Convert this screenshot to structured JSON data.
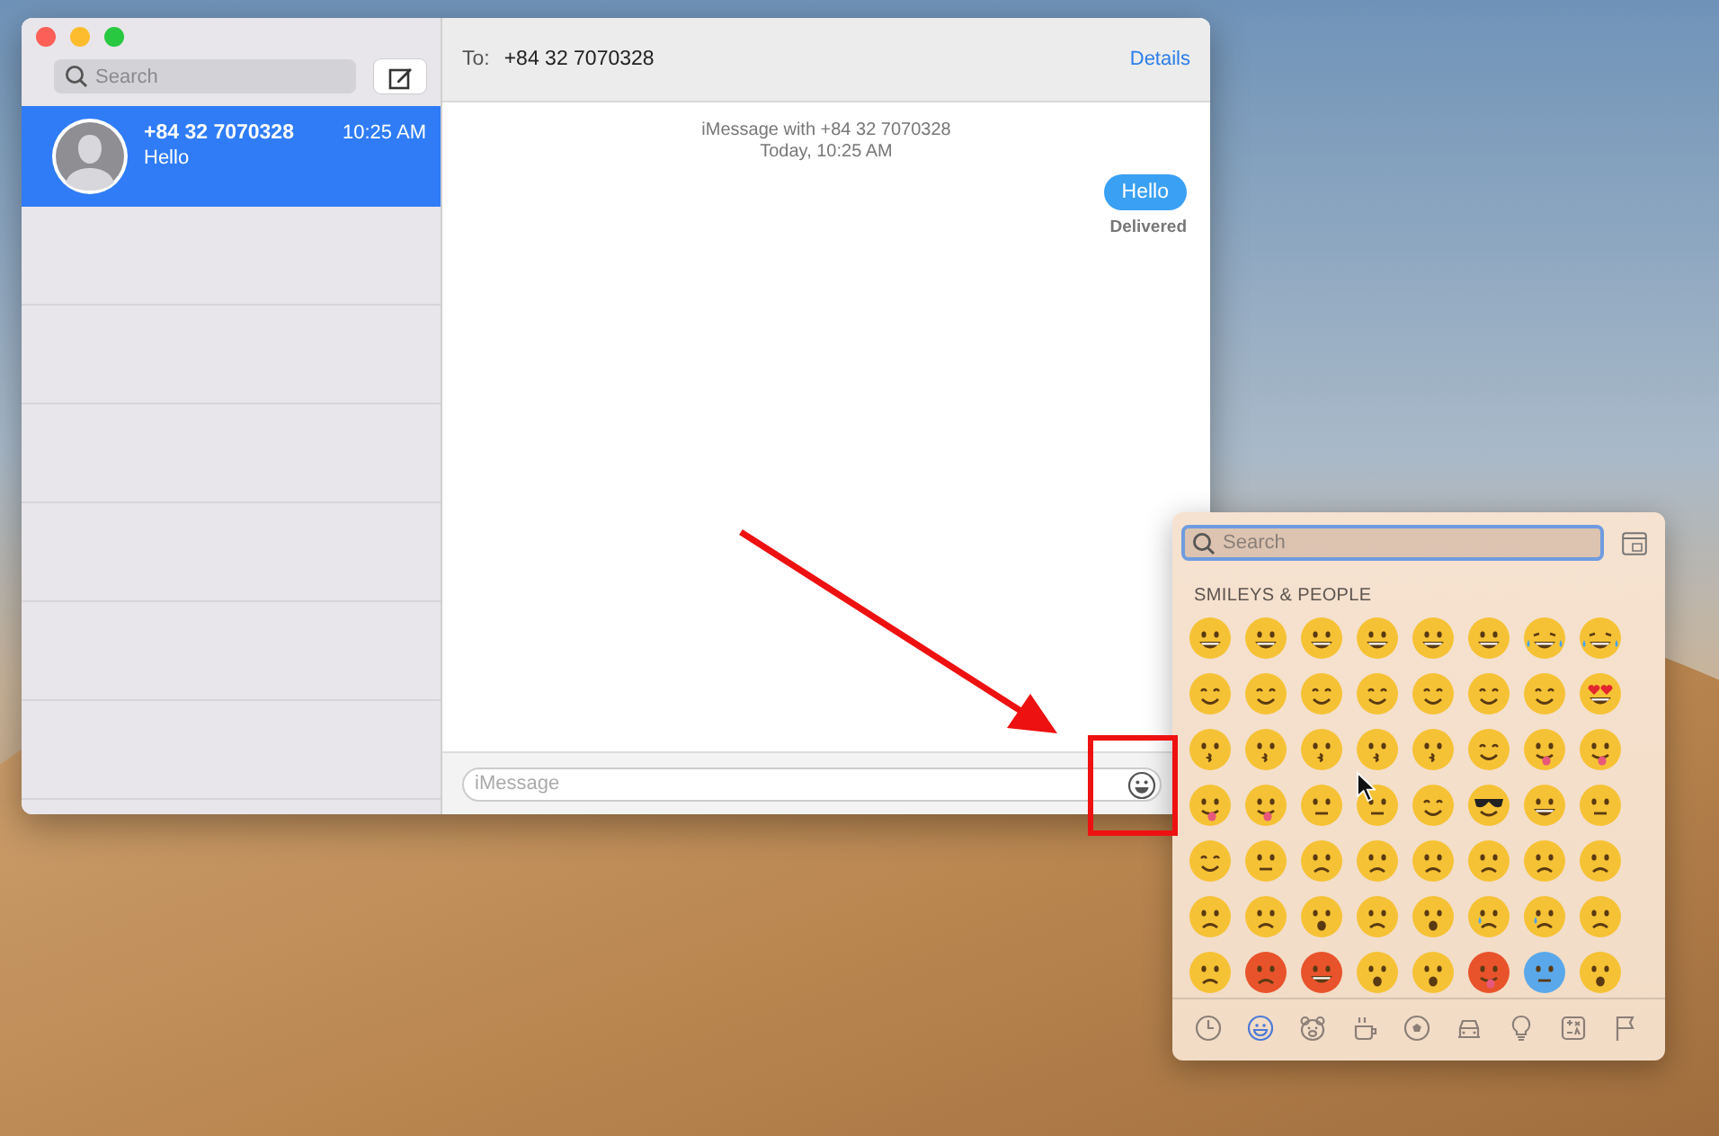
{
  "window": {
    "controls": [
      {
        "color": "#fc5f57"
      },
      {
        "color": "#fdbc2e"
      },
      {
        "color": "#28c840"
      }
    ]
  },
  "sidebar": {
    "search": {
      "placeholder": "Search"
    },
    "conversations": [
      {
        "name": "+84 32 7070328",
        "time": "10:25 AM",
        "preview": "Hello",
        "selected": true
      }
    ]
  },
  "conversation": {
    "to_label": "To:",
    "recipient": "+84 32 7070328",
    "details": "Details",
    "header": "iMessage with +84 32 7070328",
    "date": "Today, 10:25 AM",
    "messages": [
      {
        "text": "Hello",
        "outgoing": true,
        "status": "Delivered"
      }
    ],
    "input": {
      "placeholder": "iMessage"
    }
  },
  "emoji_picker": {
    "search": {
      "placeholder": "Search",
      "focused": true
    },
    "section": "SMILEYS & PEOPLE",
    "emojis": [
      {
        "kind": "grin",
        "color": "#f6c235"
      },
      {
        "kind": "grin",
        "color": "#f6c235"
      },
      {
        "kind": "grin",
        "color": "#f6c235"
      },
      {
        "kind": "grin",
        "color": "#f6c235"
      },
      {
        "kind": "grin",
        "color": "#f6c235"
      },
      {
        "kind": "grin",
        "color": "#f6c235"
      },
      {
        "kind": "laugh",
        "color": "#f6c235"
      },
      {
        "kind": "laugh",
        "color": "#f6c235"
      },
      {
        "kind": "smile",
        "color": "#f6c235"
      },
      {
        "kind": "smile",
        "color": "#f6c235"
      },
      {
        "kind": "smile",
        "color": "#f6c235"
      },
      {
        "kind": "smile",
        "color": "#f6c235"
      },
      {
        "kind": "smile",
        "color": "#f6c235"
      },
      {
        "kind": "smile",
        "color": "#f6c235"
      },
      {
        "kind": "smile",
        "color": "#f6c235"
      },
      {
        "kind": "hearteyes",
        "color": "#f6c235"
      },
      {
        "kind": "kiss",
        "color": "#f6c235"
      },
      {
        "kind": "kiss",
        "color": "#f6c235"
      },
      {
        "kind": "kiss",
        "color": "#f6c235"
      },
      {
        "kind": "kiss",
        "color": "#f6c235"
      },
      {
        "kind": "kiss",
        "color": "#f6c235"
      },
      {
        "kind": "smile",
        "color": "#f6c235"
      },
      {
        "kind": "tongue",
        "color": "#f6c235"
      },
      {
        "kind": "tongue",
        "color": "#f6c235"
      },
      {
        "kind": "tongue",
        "color": "#f6c235"
      },
      {
        "kind": "tongue",
        "color": "#f6c235"
      },
      {
        "kind": "neutral",
        "color": "#f6c235"
      },
      {
        "kind": "neutral",
        "color": "#f6c235"
      },
      {
        "kind": "smile",
        "color": "#f6c235"
      },
      {
        "kind": "cool",
        "color": "#f6c235"
      },
      {
        "kind": "grin",
        "color": "#f6c235"
      },
      {
        "kind": "neutral",
        "color": "#f6c235"
      },
      {
        "kind": "smile",
        "color": "#f6c235"
      },
      {
        "kind": "neutral",
        "color": "#f6c235"
      },
      {
        "kind": "frown",
        "color": "#f6c235"
      },
      {
        "kind": "frown",
        "color": "#f6c235"
      },
      {
        "kind": "frown",
        "color": "#f6c235"
      },
      {
        "kind": "frown",
        "color": "#f6c235"
      },
      {
        "kind": "frown",
        "color": "#f6c235"
      },
      {
        "kind": "frown",
        "color": "#f6c235"
      },
      {
        "kind": "frown",
        "color": "#f6c235"
      },
      {
        "kind": "frown",
        "color": "#f6c235"
      },
      {
        "kind": "open",
        "color": "#f6c235"
      },
      {
        "kind": "frown",
        "color": "#f6c235"
      },
      {
        "kind": "open",
        "color": "#f6c235"
      },
      {
        "kind": "cry",
        "color": "#f6c235"
      },
      {
        "kind": "cry",
        "color": "#f6c235"
      },
      {
        "kind": "frown",
        "color": "#f6c235"
      },
      {
        "kind": "frown",
        "color": "#f6c235"
      },
      {
        "kind": "frown",
        "color": "#e8532b"
      },
      {
        "kind": "grin",
        "color": "#e8532b"
      },
      {
        "kind": "open",
        "color": "#f6c235"
      },
      {
        "kind": "open",
        "color": "#f6c235"
      },
      {
        "kind": "tongue",
        "color": "#e8532b"
      },
      {
        "kind": "neutral",
        "color": "#5aa8ea"
      },
      {
        "kind": "open",
        "color": "#f6c235"
      }
    ],
    "categories": [
      {
        "kind": "clock",
        "selected": false
      },
      {
        "kind": "smiley",
        "selected": true
      },
      {
        "kind": "bear",
        "selected": false
      },
      {
        "kind": "cup",
        "selected": false
      },
      {
        "kind": "ball",
        "selected": false
      },
      {
        "kind": "car",
        "selected": false
      },
      {
        "kind": "bulb",
        "selected": false
      },
      {
        "kind": "symbols",
        "selected": false
      },
      {
        "kind": "flag",
        "selected": false
      }
    ]
  },
  "annotations": {
    "arrow": true,
    "highlight_box": true
  }
}
